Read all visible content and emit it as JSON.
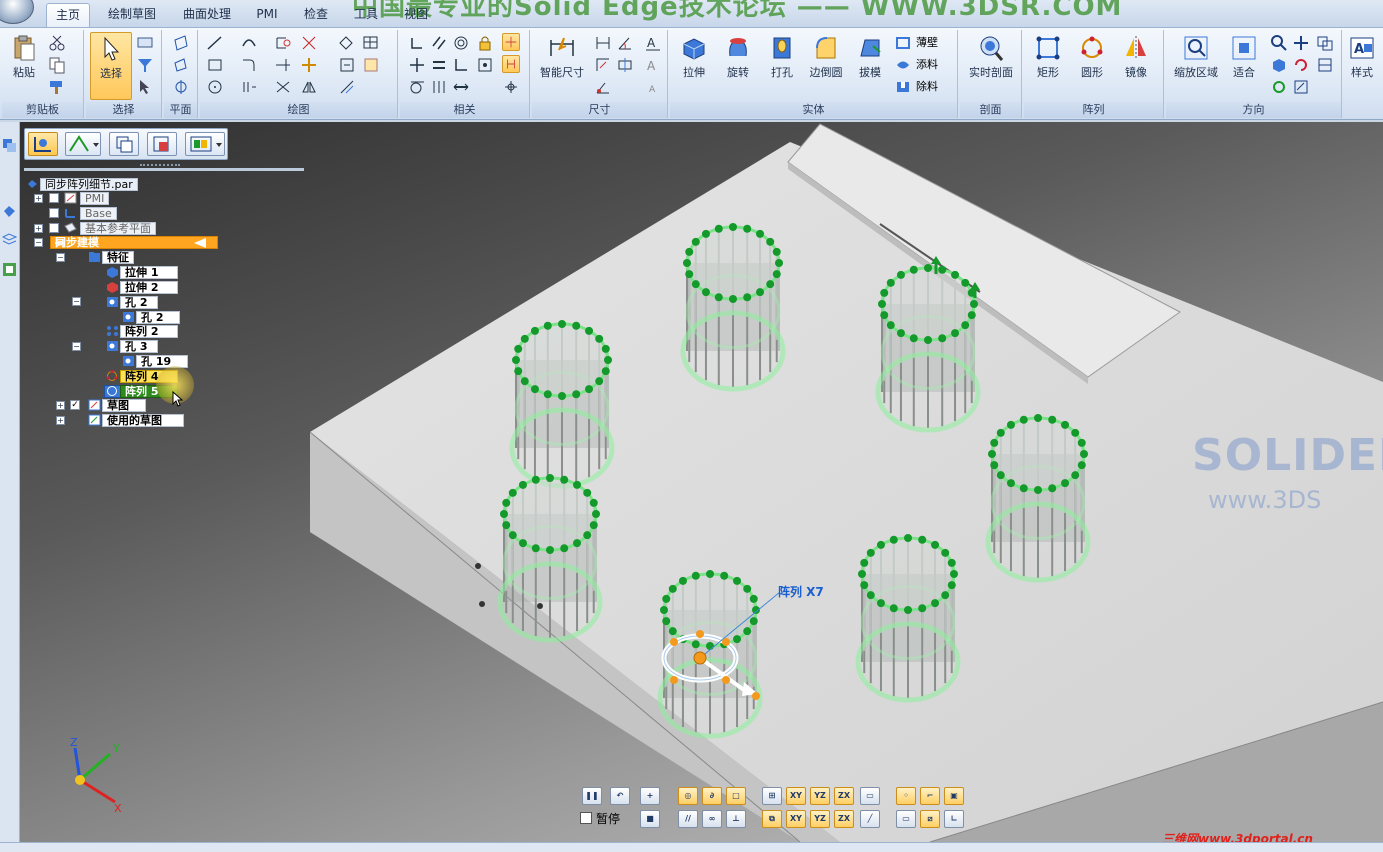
{
  "ribbon": {
    "banner": "中国最专业的Solid Edge技术论坛 —— WWW.3DSR.COM",
    "tabs": [
      "主页",
      "绘制草图",
      "曲面处理",
      "PMI",
      "检查",
      "工具",
      "视图"
    ],
    "groups": {
      "clipboard": "剪贴板",
      "select": "选择",
      "plane": "平面",
      "draw": "绘图",
      "relate": "相关",
      "dimension": "尺寸",
      "solids": "实体",
      "section": "剖面",
      "pattern": "阵列",
      "orient": "方向"
    },
    "buttons": {
      "paste": "粘贴",
      "select": "选择",
      "smart_dim": "智能尺寸",
      "extrude": "拉伸",
      "revolve": "旋转",
      "hole": "打孔",
      "round": "边倒圆",
      "draft": "拔模",
      "thin_wall": "薄壁",
      "add": "添料",
      "remove": "除料",
      "live_section": "实时剖面",
      "rect_pattern": "矩形",
      "circ_pattern": "圆形",
      "mirror": "镜像",
      "zoom_area": "缩放区域",
      "fit": "适合",
      "styles": "样式"
    }
  },
  "tree": {
    "file": "同步阵列细节.par",
    "items": [
      {
        "label": "PMI",
        "style": "dim"
      },
      {
        "label": "Base",
        "style": "dim"
      },
      {
        "label": "基本参考平面",
        "style": "dim"
      },
      {
        "label": "同步建模",
        "style": "orange"
      },
      {
        "label": "特征",
        "style": "plain"
      },
      {
        "label": "拉伸 1",
        "style": "plain"
      },
      {
        "label": "拉伸 2",
        "style": "plain"
      },
      {
        "label": "孔 2",
        "style": "plain"
      },
      {
        "label": "孔 2",
        "style": "plain"
      },
      {
        "label": "阵列 2",
        "style": "plain"
      },
      {
        "label": "孔 3",
        "style": "plain"
      },
      {
        "label": "孔 19",
        "style": "plain"
      },
      {
        "label": "阵列 4",
        "style": "yellow"
      },
      {
        "label": "阵列 5",
        "style": "selected"
      },
      {
        "label": "草图",
        "style": "plain"
      },
      {
        "label": "使用的草图",
        "style": "plain"
      }
    ]
  },
  "viewport": {
    "pattern_annotation": "阵列 X7",
    "logo_big": "SOLIDED",
    "logo_small": "www.3DS",
    "axes": {
      "x": "X",
      "y": "Y",
      "z": "Z"
    }
  },
  "commandbar": {
    "pause_label": "暂停"
  },
  "credit": "三维网www.3dportal.cn",
  "colors": {
    "accent_orange": "#ffa520",
    "selection_green": "#2e8a1e",
    "highlight_yellow": "#ffe25a"
  }
}
